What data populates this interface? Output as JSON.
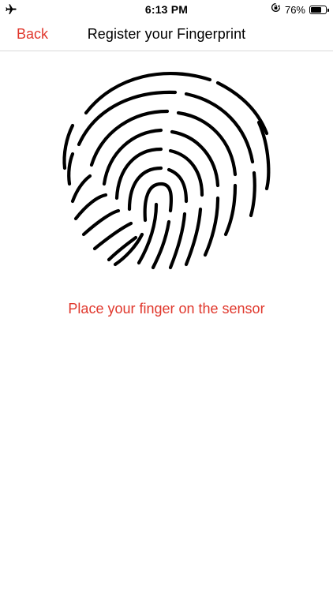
{
  "status_bar": {
    "time": "6:13 PM",
    "battery_percent_label": "76%",
    "battery_level": 0.76,
    "left_icon": "airplane-icon",
    "right_icon": "orientation-lock-icon"
  },
  "nav": {
    "back_label": "Back",
    "title": "Register your Fingerprint"
  },
  "main": {
    "fingerprint_icon": "fingerprint-icon",
    "instruction": "Place your finger on the sensor"
  },
  "colors": {
    "accent": "#e0372c",
    "text": "#000000",
    "background": "#ffffff",
    "divider": "#d9d9d9"
  }
}
